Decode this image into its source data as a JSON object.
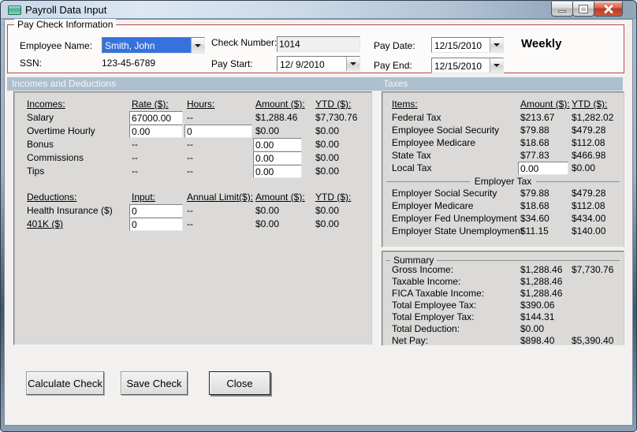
{
  "window": {
    "title": "Payroll Data Input",
    "minimize_icon": "minimize",
    "maximize_icon": "maximize",
    "close_icon": "close"
  },
  "colors": {
    "group_border_red": "#b94a4b",
    "section_strip_blue": "#aebfce",
    "selection_blue": "#3672dd",
    "close_button_red": "#cf5b3c",
    "panel_gray": "#dbdad9"
  },
  "paycheck": {
    "group_title": "Pay Check Information",
    "employee_name_label": "Employee Name:",
    "employee_name_value": "Smith, John",
    "ssn_label": "SSN:",
    "ssn_value": "123-45-6789",
    "check_number_label": "Check Number:",
    "check_number_value": "1014",
    "pay_start_label": "Pay Start:",
    "pay_start_value": "12/ 9/2010",
    "pay_date_label": "Pay Date:",
    "pay_date_value": "12/15/2010",
    "pay_end_label": "Pay End:",
    "pay_end_value": "12/15/2010",
    "frequency": "Weekly"
  },
  "sections": {
    "left_header": "Incomes and Deductions",
    "right_header": "Taxes"
  },
  "incomes": {
    "h_items": "Incomes:",
    "h_rate": "Rate ($):",
    "h_hours": "Hours:",
    "h_amount": "Amount ($):",
    "h_ytd": "YTD ($):",
    "salary": {
      "label": "Salary",
      "rate": "67000.00",
      "hours": "--",
      "amount": "$1,288.46",
      "ytd": "$7,730.76"
    },
    "overtime": {
      "label": "Overtime Hourly",
      "rate": "0.00",
      "hours": "0",
      "amount": "$0.00",
      "ytd": "$0.00"
    },
    "bonus": {
      "label": "Bonus",
      "rate": "--",
      "hours": "--",
      "amount": "0.00",
      "ytd": "$0.00"
    },
    "commissions": {
      "label": "Commissions",
      "rate": "--",
      "hours": "--",
      "amount": "0.00",
      "ytd": "$0.00"
    },
    "tips": {
      "label": "Tips",
      "rate": "--",
      "hours": "--",
      "amount": "0.00",
      "ytd": "$0.00"
    }
  },
  "deductions": {
    "h_items": "Deductions:",
    "h_input": "Input:",
    "h_limit": "Annual Limit($):",
    "h_amount": "Amount ($):",
    "h_ytd": "YTD ($):",
    "health": {
      "label": "Health Insurance  ($)",
      "input": "0",
      "limit": "--",
      "amount": "$0.00",
      "ytd": "$0.00"
    },
    "k401": {
      "label": "401K  ($)",
      "input": "0",
      "limit": "--",
      "amount": "$0.00",
      "ytd": "$0.00"
    }
  },
  "taxes": {
    "h_items": "Items:",
    "h_amount": "Amount ($):",
    "h_ytd": "YTD ($):",
    "federal": {
      "label": "Federal Tax",
      "amount": "$213.67",
      "ytd": "$1,282.02"
    },
    "emp_ss": {
      "label": "Employee Social Security",
      "amount": "$79.88",
      "ytd": "$479.28"
    },
    "emp_medicare": {
      "label": "Employee Medicare",
      "amount": "$18.68",
      "ytd": "$112.08"
    },
    "state": {
      "label": "State Tax",
      "amount": "$77.83",
      "ytd": "$466.98"
    },
    "local": {
      "label": "Local Tax",
      "amount": "0.00",
      "ytd": "$0.00"
    },
    "employer_group_title": "Employer Tax",
    "er_ss": {
      "label": "Employer Social Security",
      "amount": "$79.88",
      "ytd": "$479.28"
    },
    "er_medicare": {
      "label": "Employer Medicare",
      "amount": "$18.68",
      "ytd": "$112.08"
    },
    "er_fed_unemp": {
      "label": "Employer Fed Unemployment",
      "amount": "$34.60",
      "ytd": "$434.00"
    },
    "er_state_unemp": {
      "label": "Employer State Unemployment",
      "amount": "$11.15",
      "ytd": "$140.00"
    }
  },
  "summary": {
    "title": "Summary",
    "gross": {
      "label": "Gross Income:",
      "amount": "$1,288.46",
      "ytd": "$7,730.76"
    },
    "taxable": {
      "label": "Taxable Income:",
      "amount": "$1,288.46",
      "ytd": ""
    },
    "fica": {
      "label": "FICA Taxable Income:",
      "amount": "$1,288.46",
      "ytd": ""
    },
    "total_emp_tax": {
      "label": "Total Employee Tax:",
      "amount": "$390.06",
      "ytd": ""
    },
    "total_er_tax": {
      "label": "Total Employer Tax:",
      "amount": "$144.31",
      "ytd": ""
    },
    "total_deduction": {
      "label": "Total Deduction:",
      "amount": "$0.00",
      "ytd": ""
    },
    "net_pay": {
      "label": "Net Pay:",
      "amount": "$898.40",
      "ytd": "$5,390.40"
    }
  },
  "buttons": {
    "calculate": "Calculate Check",
    "save": "Save Check",
    "close": "Close"
  }
}
